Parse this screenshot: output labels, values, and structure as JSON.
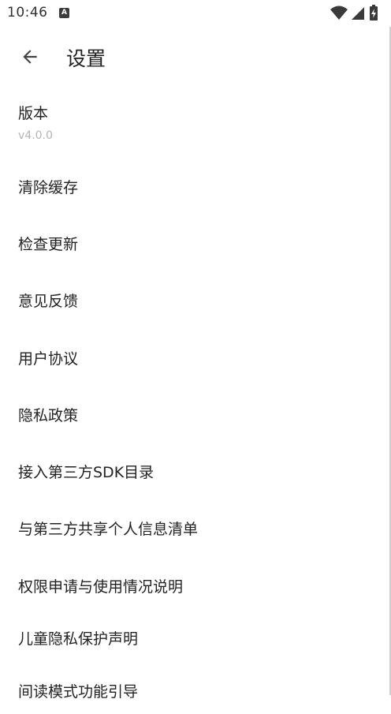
{
  "status_bar": {
    "time": "10:46",
    "notification_glyph": "A"
  },
  "header": {
    "title": "设置"
  },
  "version": {
    "label": "版本",
    "value": "v4.0.0"
  },
  "items": [
    {
      "label": "清除缓存"
    },
    {
      "label": "检查更新"
    },
    {
      "label": "意见反馈"
    },
    {
      "label": "用户协议"
    },
    {
      "label": "隐私政策"
    },
    {
      "label": "接入第三方SDK目录"
    },
    {
      "label": "与第三方共享个人信息清单"
    },
    {
      "label": "权限申请与使用情况说明"
    },
    {
      "label": "儿童隐私保护声明"
    },
    {
      "label": "间读模式功能引导"
    }
  ]
}
